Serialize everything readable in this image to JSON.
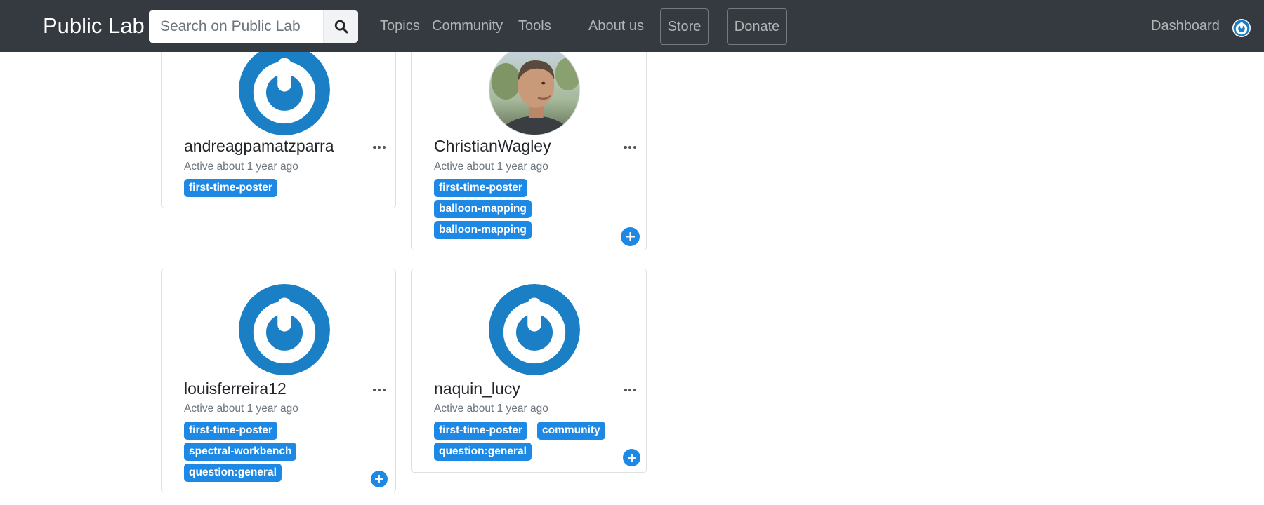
{
  "navbar": {
    "brand": "Public Lab",
    "search": {
      "placeholder": "Search on Public Lab",
      "value": ""
    },
    "links": {
      "topics": "Topics",
      "community": "Community",
      "tools": "Tools",
      "about": "About us"
    },
    "buttons": {
      "store": "Store",
      "donate": "Donate"
    },
    "dashboard": "Dashboard",
    "user_avatar": "gravatar-power-icon"
  },
  "colors": {
    "navbar_bg": "#343a40",
    "tag_bg": "#1e88e5",
    "default_avatar_blue": "#1a7fc4"
  },
  "profiles": [
    {
      "username": "andreagpamatzparra",
      "activity": "Active about 1 year ago",
      "avatar": "default-gravatar",
      "tags": [
        "first-time-poster"
      ]
    },
    {
      "username": "ChristianWagley",
      "activity": "Active about 1 year ago",
      "avatar": "profile-photo",
      "tags": [
        "first-time-poster",
        "balloon-mapping",
        "balloon-mapping"
      ]
    },
    {
      "username": "louisferreira12",
      "activity": "Active about 1 year ago",
      "avatar": "default-gravatar",
      "tags": [
        "first-time-poster",
        "spectral-workbench",
        "question:general"
      ]
    },
    {
      "username": "naquin_lucy",
      "activity": "Active about 1 year ago",
      "avatar": "default-gravatar",
      "tags": [
        "first-time-poster",
        "community",
        "question:general"
      ]
    }
  ]
}
